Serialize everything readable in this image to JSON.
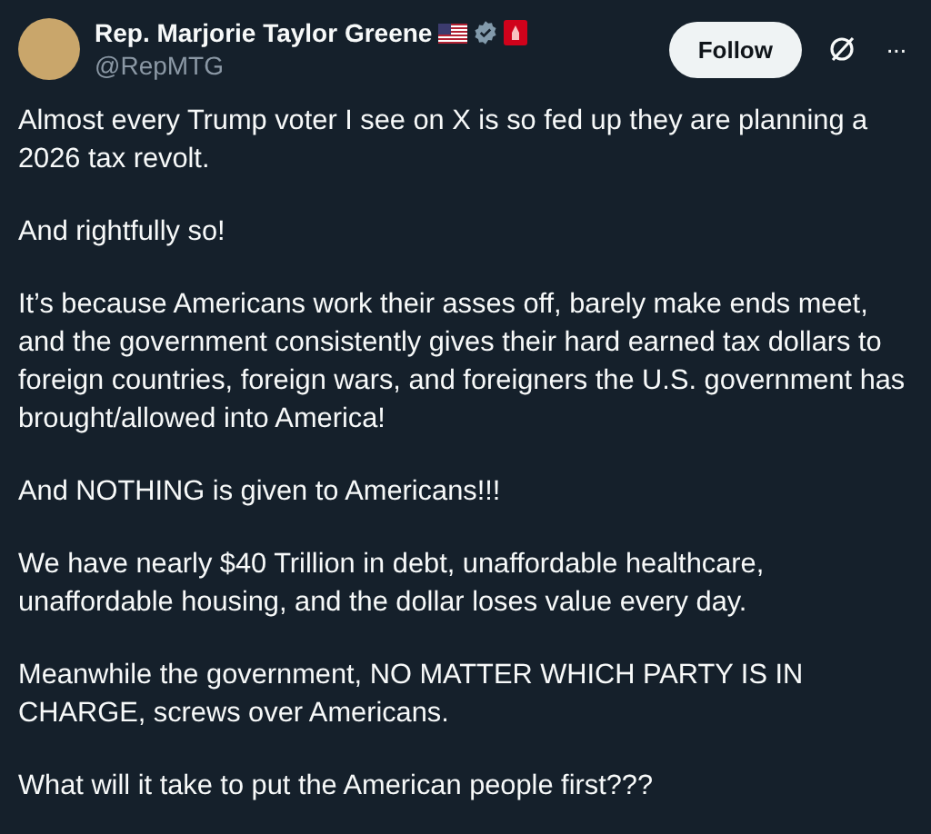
{
  "author": {
    "name": "Rep. Marjorie Taylor Greene",
    "handle": "@RepMTG",
    "verified": true
  },
  "follow_button": "Follow",
  "more_button": "···",
  "paragraphs": [
    "Almost every Trump voter I see on X is so fed up they are planning a 2026 tax revolt.",
    "And rightfully so!",
    "It’s because Americans work their asses off, barely make ends meet, and the government consistently gives their hard earned tax dollars to foreign countries, foreign wars, and foreigners the U.S. government has brought/allowed into America!",
    "And NOTHING is given to Americans!!!",
    "We have nearly $40 Trillion in debt, unaffordable healthcare, unaffordable housing, and the dollar loses value every day.",
    "Meanwhile the government, NO MATTER WHICH PARTY IS IN CHARGE, screws over Americans.",
    "What will it take to put the American people first???"
  ]
}
